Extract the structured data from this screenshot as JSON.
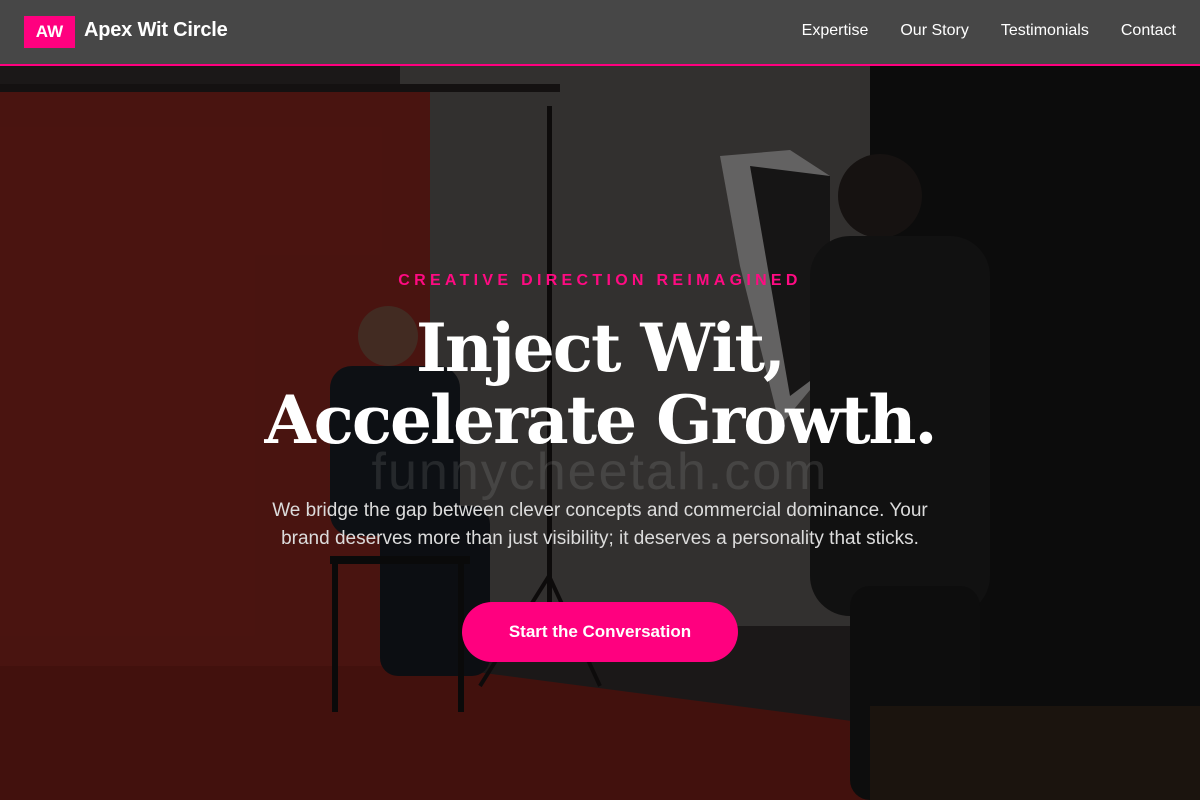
{
  "header": {
    "logo_text": "AW",
    "brand_name": "Apex Wit Circle",
    "nav": [
      {
        "label": "Expertise"
      },
      {
        "label": "Our Story"
      },
      {
        "label": "Testimonials"
      },
      {
        "label": "Contact"
      }
    ]
  },
  "hero": {
    "eyebrow": "CREATIVE DIRECTION REIMAGINED",
    "headline_line1": "Inject Wit,",
    "headline_line2": "Accelerate Growth.",
    "watermark": "funnycheetah.com",
    "subtitle": "We bridge the gap between clever concepts and commercial dominance. Your brand deserves more than just visibility; it deserves a personality that sticks.",
    "cta_label": "Start the Conversation"
  },
  "colors": {
    "accent": "#ff007f",
    "header_bg": "#474747",
    "text": "#ffffff"
  }
}
